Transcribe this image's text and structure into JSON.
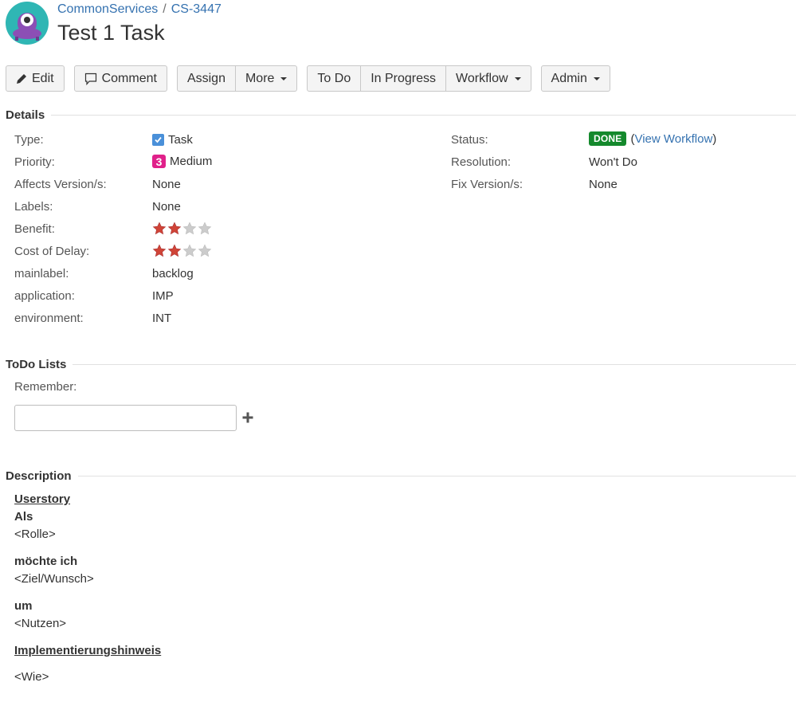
{
  "breadcrumb": {
    "project": "CommonServices",
    "separator": "/",
    "issue_key": "CS-3447"
  },
  "issue": {
    "summary": "Test 1 Task"
  },
  "toolbar": {
    "edit": "Edit",
    "comment": "Comment",
    "assign": "Assign",
    "more": "More",
    "todo": "To Do",
    "in_progress": "In Progress",
    "workflow": "Workflow",
    "admin": "Admin"
  },
  "details": {
    "heading": "Details",
    "left": [
      {
        "label": "Type:",
        "value": "Task",
        "icon": "task-checkbox-icon"
      },
      {
        "label": "Priority:",
        "value": "Medium",
        "icon_text": "3"
      },
      {
        "label": "Affects Version/s:",
        "value": "None"
      },
      {
        "label": "Labels:",
        "value": "None"
      },
      {
        "label": "Benefit:",
        "rating": 2,
        "max": 4
      },
      {
        "label": "Cost of Delay:",
        "rating": 2,
        "max": 4
      },
      {
        "label": "mainlabel:",
        "value": "backlog"
      },
      {
        "label": "application:",
        "value": "IMP"
      },
      {
        "label": "environment:",
        "value": "INT"
      }
    ],
    "right": [
      {
        "label": "Status:",
        "value": "DONE",
        "open_paren": "(",
        "link": "View Workflow",
        "close_paren": ")"
      },
      {
        "label": "Resolution:",
        "value": "Won't Do"
      },
      {
        "label": "Fix Version/s:",
        "value": "None"
      }
    ]
  },
  "todo": {
    "heading": "ToDo Lists",
    "label": "Remember:",
    "input_value": ""
  },
  "description": {
    "heading": "Description",
    "userstory": "Userstory",
    "als": "Als",
    "rolle": "<Rolle>",
    "moechte": "möchte ich",
    "ziel": "<Ziel/Wunsch>",
    "um": "um",
    "nutzen": "<Nutzen>",
    "impl": "Implementierungshinweis",
    "wie": "<Wie>"
  },
  "colors": {
    "link": "#3572b0",
    "done_lozenge": "#14892c",
    "priority_medium": "#e0218a",
    "task_icon": "#4a90d9",
    "star_filled": "#d04437",
    "star_empty": "#cccccc"
  }
}
